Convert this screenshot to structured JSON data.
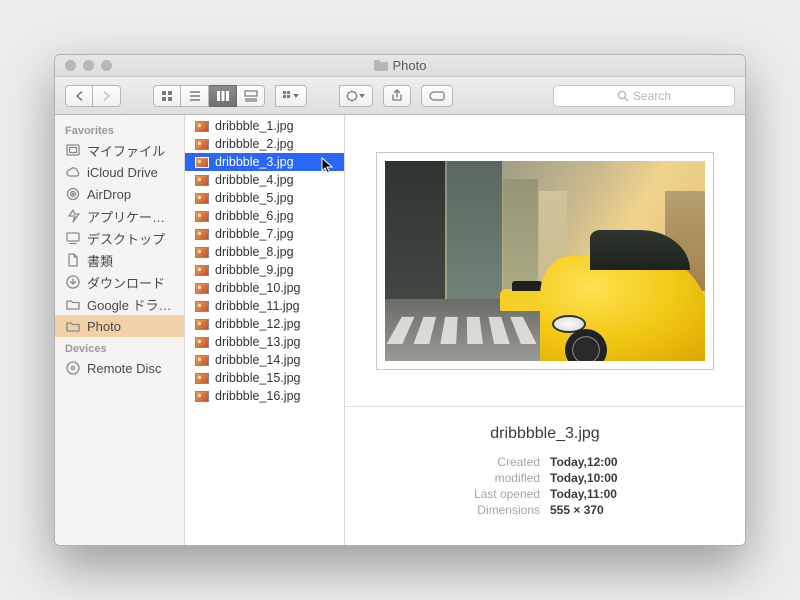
{
  "window": {
    "title": "Photo"
  },
  "toolbar": {
    "search_placeholder": "Search"
  },
  "sidebar": {
    "sections": [
      {
        "label": "Favorites",
        "items": [
          {
            "icon": "myfiles",
            "label": "マイファイル"
          },
          {
            "icon": "cloud",
            "label": "iCloud Drive"
          },
          {
            "icon": "airdrop",
            "label": "AirDrop"
          },
          {
            "icon": "apps",
            "label": "アプリケー…"
          },
          {
            "icon": "desktop",
            "label": "デスクトップ"
          },
          {
            "icon": "docs",
            "label": "書類"
          },
          {
            "icon": "downloads",
            "label": "ダウンロード"
          },
          {
            "icon": "folder",
            "label": "Google ドラ…"
          },
          {
            "icon": "folder",
            "label": "Photo",
            "selected": true
          }
        ]
      },
      {
        "label": "Devices",
        "items": [
          {
            "icon": "disc",
            "label": "Remote Disc"
          }
        ]
      }
    ]
  },
  "files": [
    {
      "name": "dribbble_1.jpg"
    },
    {
      "name": "dribbble_2.jpg"
    },
    {
      "name": "dribbble_3.jpg",
      "selected": true
    },
    {
      "name": "dribbble_4.jpg"
    },
    {
      "name": "dribbble_5.jpg"
    },
    {
      "name": "dribbble_6.jpg"
    },
    {
      "name": "dribbble_7.jpg"
    },
    {
      "name": "dribbble_8.jpg"
    },
    {
      "name": "dribbble_9.jpg"
    },
    {
      "name": "dribbble_10.jpg"
    },
    {
      "name": "dribbble_11.jpg"
    },
    {
      "name": "dribbble_12.jpg"
    },
    {
      "name": "dribbble_13.jpg"
    },
    {
      "name": "dribbble_14.jpg"
    },
    {
      "name": "dribbble_15.jpg"
    },
    {
      "name": "dribbble_16.jpg"
    }
  ],
  "preview": {
    "name": "dribbbble_3.jpg",
    "meta": [
      {
        "k": "Created",
        "v": "Today,12:00"
      },
      {
        "k": "modifled",
        "v": "Today,10:00"
      },
      {
        "k": "Last opened",
        "v": "Today,11:00"
      },
      {
        "k": "Dimensions",
        "v": "555 × 370"
      }
    ]
  }
}
